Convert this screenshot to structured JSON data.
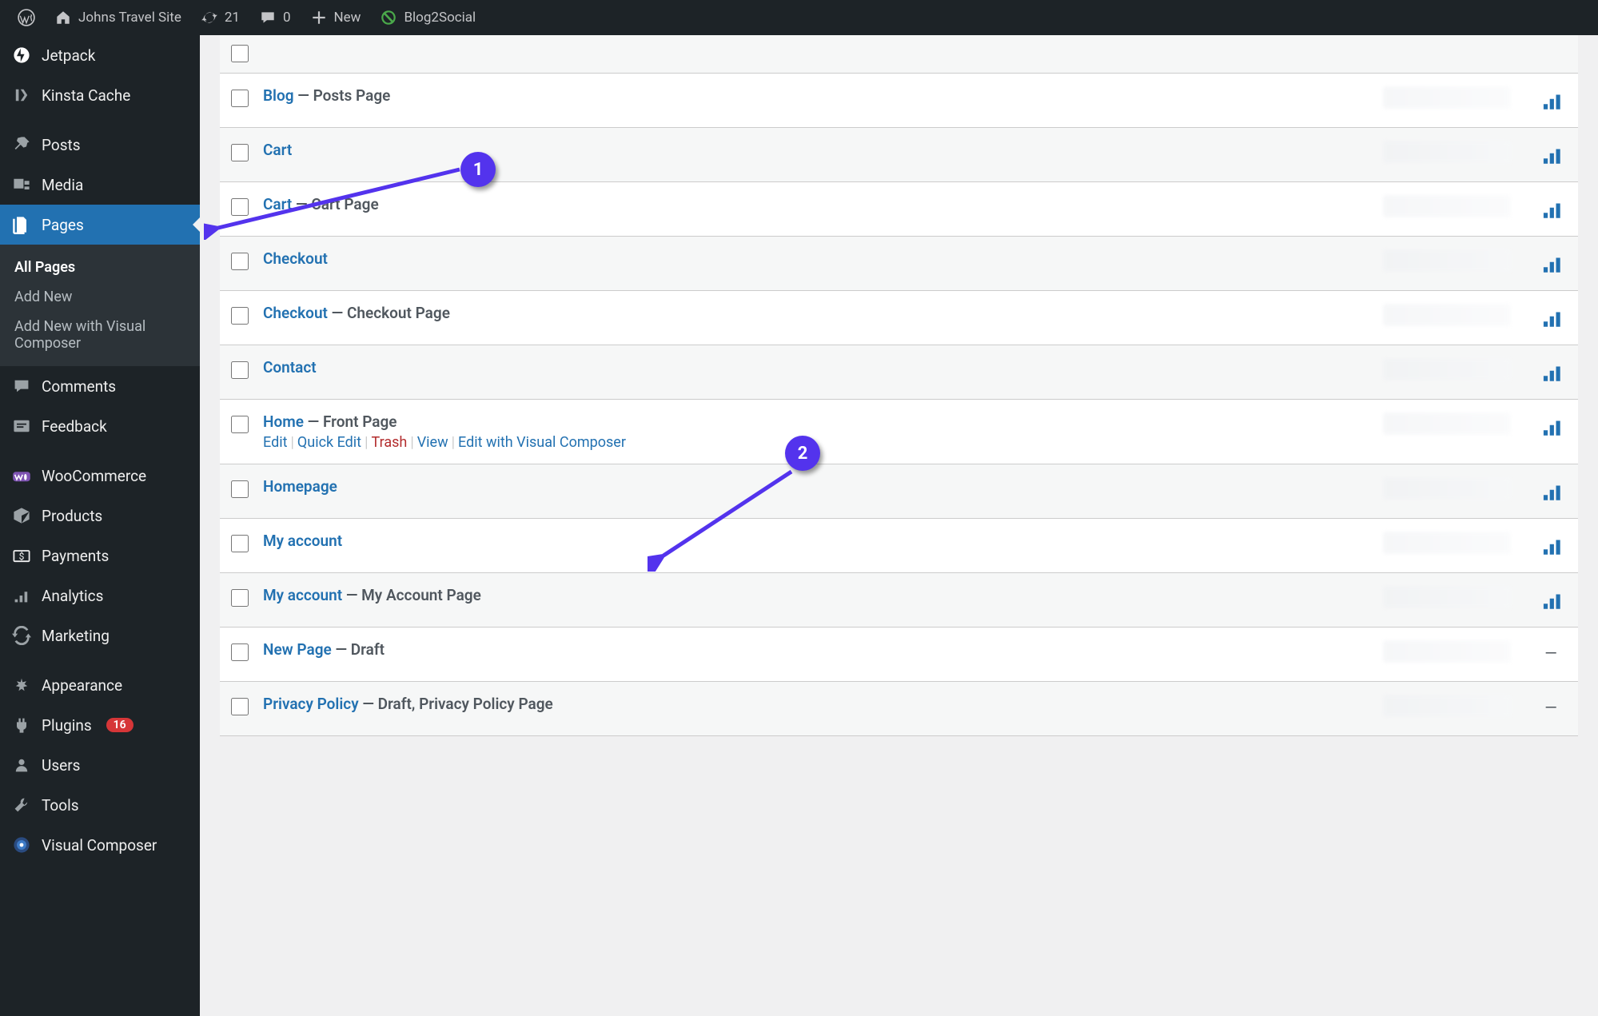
{
  "adminbar": {
    "site_name": "Johns Travel Site",
    "updates_count": "21",
    "comments_count": "0",
    "new_label": "New",
    "blog2social_label": "Blog2Social"
  },
  "adminmenu": {
    "items": [
      {
        "key": "jetpack",
        "label": "Jetpack",
        "icon": "jetpack"
      },
      {
        "key": "kinsta",
        "label": "Kinsta Cache",
        "icon": "kinsta"
      },
      {
        "spacer": true
      },
      {
        "key": "posts",
        "label": "Posts",
        "icon": "pin"
      },
      {
        "key": "media",
        "label": "Media",
        "icon": "media"
      },
      {
        "key": "pages",
        "label": "Pages",
        "icon": "pages",
        "current": true
      },
      {
        "submenu": true,
        "items": [
          {
            "label": "All Pages",
            "current": true
          },
          {
            "label": "Add New"
          },
          {
            "label": "Add New with Visual Composer"
          }
        ]
      },
      {
        "key": "comments",
        "label": "Comments",
        "icon": "comments"
      },
      {
        "key": "feedback",
        "label": "Feedback",
        "icon": "feedback"
      },
      {
        "spacer": true
      },
      {
        "key": "woocommerce",
        "label": "WooCommerce",
        "icon": "woo"
      },
      {
        "key": "products",
        "label": "Products",
        "icon": "products"
      },
      {
        "key": "payments",
        "label": "Payments",
        "icon": "payments"
      },
      {
        "key": "analytics",
        "label": "Analytics",
        "icon": "analytics"
      },
      {
        "key": "marketing",
        "label": "Marketing",
        "icon": "marketing"
      },
      {
        "spacer": true
      },
      {
        "key": "appearance",
        "label": "Appearance",
        "icon": "appearance"
      },
      {
        "key": "plugins",
        "label": "Plugins",
        "icon": "plugins",
        "badge": "16"
      },
      {
        "key": "users",
        "label": "Users",
        "icon": "users"
      },
      {
        "key": "tools",
        "label": "Tools",
        "icon": "tools"
      },
      {
        "key": "vc",
        "label": "Visual Composer",
        "icon": "vc"
      }
    ]
  },
  "pages": [
    {
      "title": "Blog",
      "suffix": " — Posts Page",
      "stats": true,
      "alt": true
    },
    {
      "title": "Cart",
      "suffix": "",
      "stats": true
    },
    {
      "title": "Cart",
      "suffix": " — Cart Page",
      "stats": true,
      "alt": true
    },
    {
      "title": "Checkout",
      "suffix": "",
      "stats": true
    },
    {
      "title": "Checkout",
      "suffix": " — Checkout Page",
      "stats": true,
      "alt": true
    },
    {
      "title": "Contact",
      "suffix": "",
      "stats": true
    },
    {
      "title": "Home",
      "suffix": " — Front Page",
      "stats": true,
      "alt": true,
      "show_actions": true
    },
    {
      "title": "Homepage",
      "suffix": "",
      "stats": true
    },
    {
      "title": "My account",
      "suffix": "",
      "stats": true,
      "alt": true
    },
    {
      "title": "My account",
      "suffix": " — My Account Page",
      "stats": true
    },
    {
      "title": "New Page",
      "suffix": " — Draft",
      "stats": false,
      "alt": true
    },
    {
      "title": "Privacy Policy",
      "suffix": " — Draft, Privacy Policy Page",
      "stats": false
    }
  ],
  "row_actions": {
    "edit": "Edit",
    "quick_edit": "Quick Edit",
    "trash": "Trash",
    "view": "View",
    "edit_vc": "Edit with Visual Composer"
  },
  "markers": {
    "m1": "1",
    "m2": "2"
  }
}
